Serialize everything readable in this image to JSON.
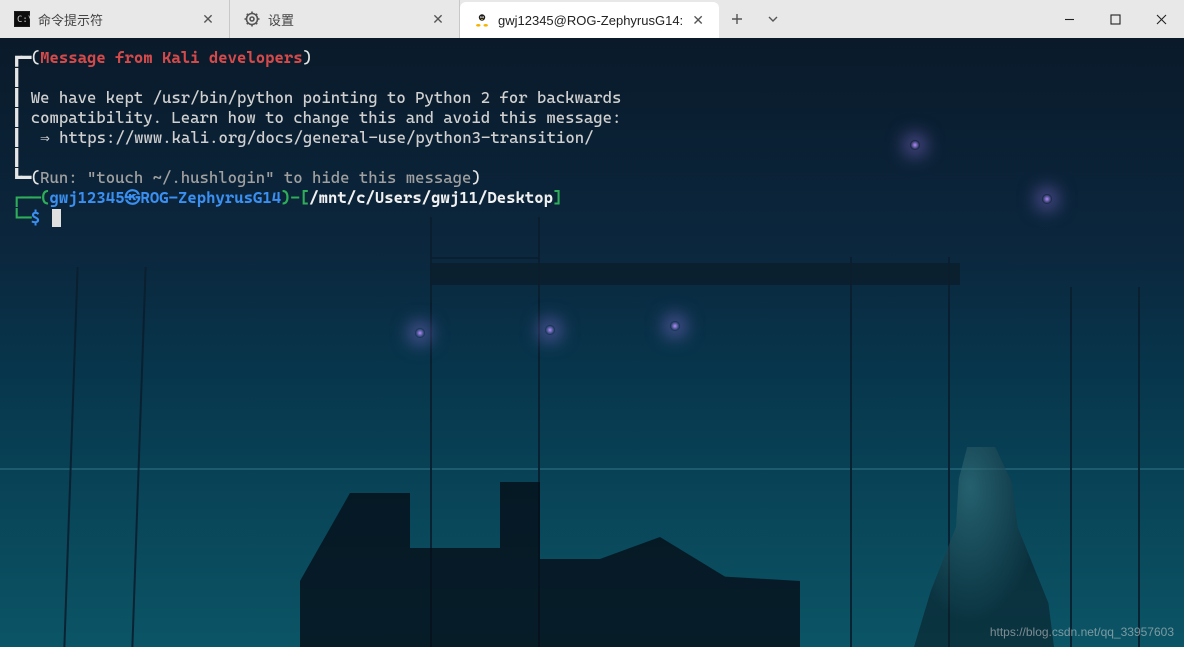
{
  "tabs": [
    {
      "label": "命令提示符",
      "active": false
    },
    {
      "label": "设置",
      "active": false
    },
    {
      "label": "gwj12345@ROG-ZephyrusG14:",
      "active": true
    }
  ],
  "motd": {
    "header": "Message from Kali developers",
    "body_line1": "We have kept /usr/bin/python pointing to Python 2 for backwards",
    "body_line2": "compatibility. Learn how to change this and avoid this message:",
    "body_link": "https://www.kali.org/docs/general-use/python3-transition/",
    "footer": "Run: \"touch ~/.hushlogin\" to hide this message"
  },
  "prompt": {
    "userhost": "gwj12345㉿ROG-ZephyrusG14",
    "sep1": ")-[",
    "cwd": "/mnt/c/Users/gwj11/Desktop",
    "sep2": "]",
    "symbol": "$"
  },
  "watermark": "https://blog.csdn.net/qq_33957603"
}
